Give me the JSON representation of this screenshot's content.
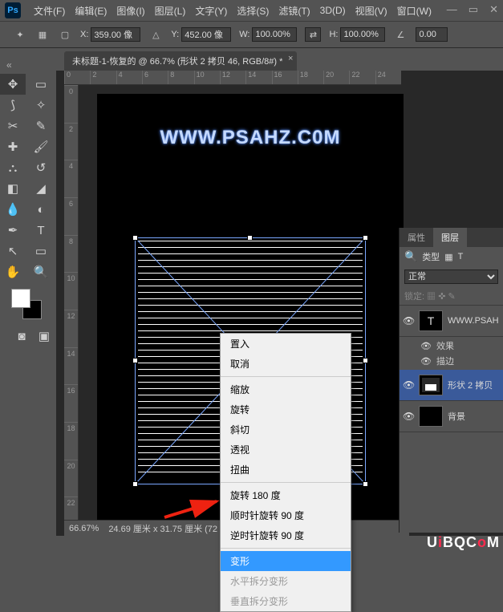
{
  "app": {
    "logo": "Ps"
  },
  "menu": {
    "file": "文件(F)",
    "edit": "编辑(E)",
    "image": "图像(I)",
    "layer": "图层(L)",
    "type": "文字(Y)",
    "select": "选择(S)",
    "filter": "滤镜(T)",
    "threed": "3D(D)",
    "view": "视图(V)",
    "window": "窗口(W)"
  },
  "options": {
    "x_label": "X:",
    "x_value": "359.00 像",
    "y_label": "Y:",
    "y_value": "452.00 像",
    "w_label": "W:",
    "w_value": "100.00%",
    "h_label": "H:",
    "h_value": "100.00%",
    "angle_value": "0.00"
  },
  "doc_tab": {
    "title": "未标题-1-恢复的 @ 66.7% (形状 2 拷贝 46, RGB/8#) *"
  },
  "ruler_h": [
    "0",
    "2",
    "4",
    "6",
    "8",
    "10",
    "12",
    "14",
    "16",
    "18",
    "20",
    "22",
    "24"
  ],
  "ruler_v": [
    "0",
    "2",
    "4",
    "6",
    "8",
    "10",
    "12",
    "14",
    "16",
    "18",
    "20",
    "22"
  ],
  "watermark": "WWW.PSAHZ.C0M",
  "context_menu": {
    "place": "置入",
    "cancel": "取消",
    "scale": "缩放",
    "rotate": "旋转",
    "skew": "斜切",
    "perspective": "透视",
    "distort": "扭曲",
    "rotate180": "旋转 180 度",
    "rotateCW": "顺时针旋转 90 度",
    "rotateCCW": "逆时针旋转 90 度",
    "warp": "变形",
    "splitH": "水平拆分变形",
    "splitV": "垂直拆分变形"
  },
  "panels": {
    "tab_props": "属性",
    "tab_layers": "图层",
    "kind_label": "类型",
    "blend_mode": "正常",
    "lock_label": "锁定:",
    "layer_text": "WWW.PSAH",
    "fx_label": "效果",
    "stroke_label": "描边",
    "shape_layer": "形状 2 拷贝",
    "bg_layer": "背景"
  },
  "status": {
    "zoom": "66.67%",
    "info": "24.69 厘米 x 31.75 厘米 (72"
  },
  "brand": {
    "u": "U",
    "i": "i",
    "b": "B",
    "q": "Q",
    ".": ".",
    "c": "C",
    "o": "o",
    "m": "M"
  }
}
